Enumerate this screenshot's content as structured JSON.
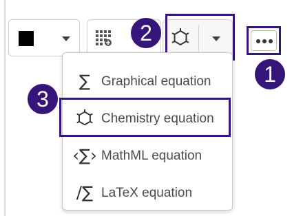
{
  "toolbar": {
    "font_color_value": "#000000",
    "equation_selected_icon": "chemistry-hexagon-icon",
    "more_icon": "ellipsis-icon"
  },
  "callouts": {
    "one": "1",
    "two": "2",
    "three": "3"
  },
  "equation_menu": {
    "items": [
      {
        "icon": "sigma-icon",
        "label": "Graphical equation"
      },
      {
        "icon": "hexagon-icon",
        "label": "Chemistry equation"
      },
      {
        "icon": "mathml-icon",
        "label": "MathML equation"
      },
      {
        "icon": "latex-icon",
        "label": "LaTeX equation"
      }
    ]
  },
  "colors": {
    "callout_fill": "#36157a",
    "highlight_border": "#36157a",
    "swatch": "#000000"
  }
}
